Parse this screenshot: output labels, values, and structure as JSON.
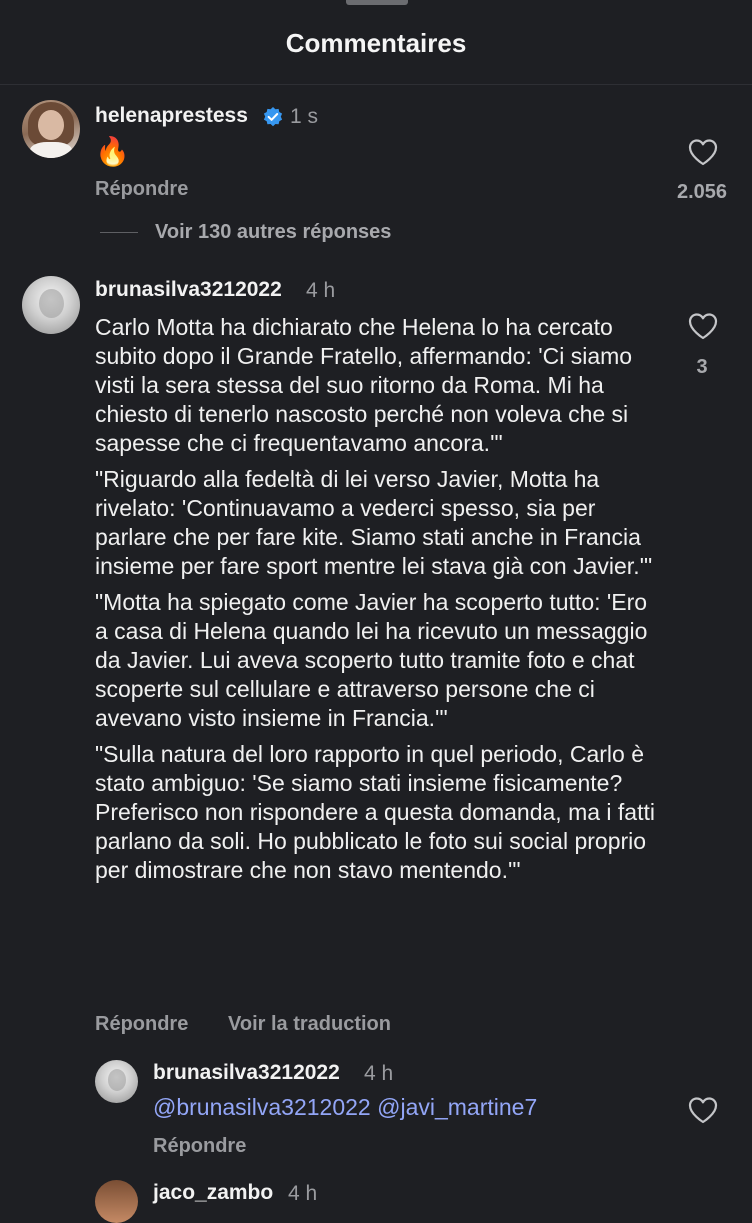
{
  "header": {
    "title": "Commentaires"
  },
  "comments": [
    {
      "username": "helenaprestess",
      "verified": true,
      "time": "1 s",
      "text": "🔥",
      "reply_label": "Répondre",
      "likes": "2.056",
      "view_replies": "Voir 130 autres réponses"
    },
    {
      "username": "brunasilva3212022",
      "time": "4 h",
      "paragraphs": [
        "Carlo Motta ha dichiarato che Helena lo ha cercato subito dopo il Grande Fratello, affermando: 'Ci siamo visti la sera stessa del suo ritorno da Roma. Mi ha chiesto di tenerlo nascosto perché non voleva che si sapesse che ci frequentavamo ancora.'\"",
        "\"Riguardo alla fedeltà di lei verso Javier, Motta ha rivelato: 'Continuavamo a vederci spesso, sia per parlare che per fare kite. Siamo stati anche in Francia insieme per fare sport mentre lei stava già con Javier.'\"",
        "\"Motta ha spiegato come Javier ha scoperto tutto: 'Ero a casa di Helena quando lei ha ricevuto un messaggio da Javier. Lui aveva scoperto tutto tramite foto e chat scoperte sul cellulare e attraverso persone che ci avevano visto insieme in Francia.'\"",
        "\"Sulla natura del loro rapporto in quel periodo, Carlo è stato ambiguo: 'Se siamo stati insieme fisicamente? Preferisco non rispondere a questa domanda, ma i fatti parlano da soli. Ho pubblicato le foto sui social proprio per dimostrare che non stavo mentendo.'\""
      ],
      "reply_label": "Répondre",
      "translate_label": "Voir la traduction",
      "likes": "3"
    },
    {
      "username": "brunasilva3212022",
      "time": "4 h",
      "text": "@brunasilva3212022 @javi_martine7",
      "reply_label": "Répondre"
    },
    {
      "username": "jaco_zambo",
      "time": "4 h"
    }
  ],
  "colors": {
    "background": "#1e1f23",
    "mention": "#93a6f7",
    "verified": "#3797f0",
    "muted": "#9a9b9f"
  },
  "icons": [
    "heart-icon",
    "verified-badge-icon",
    "drag-handle"
  ]
}
